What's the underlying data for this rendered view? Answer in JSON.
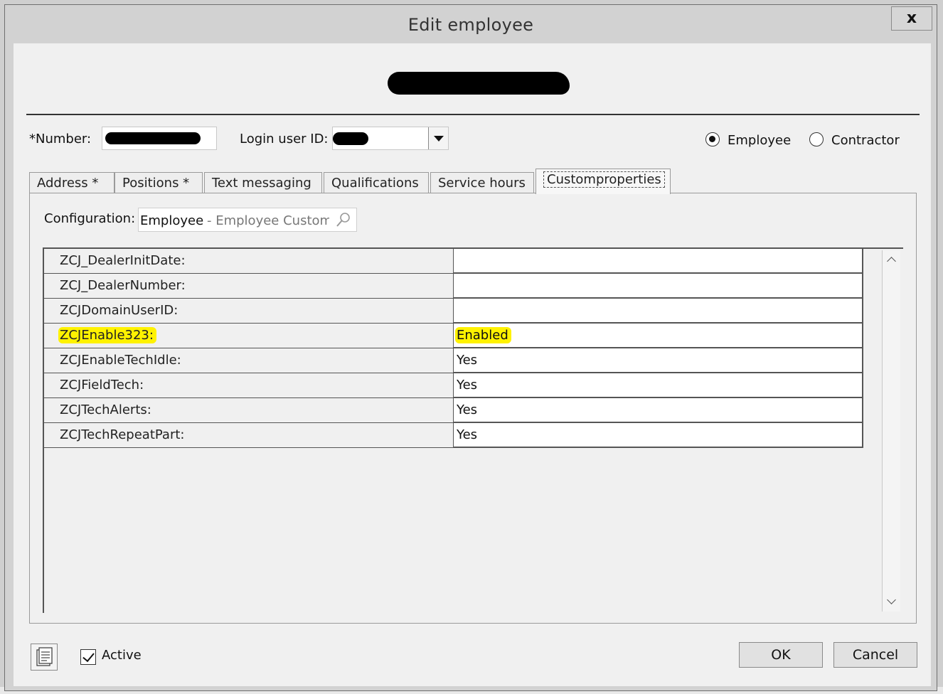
{
  "window": {
    "title": "Edit employee",
    "close_label": "x"
  },
  "employee_form": {
    "number_label": "*Number:",
    "login_label": "Login user ID:",
    "employment_type": {
      "options": [
        {
          "label": "Employee",
          "selected": true
        },
        {
          "label": "Contractor",
          "selected": false
        }
      ]
    }
  },
  "tabs": [
    {
      "label": "Address *",
      "active": false
    },
    {
      "label": "Positions *",
      "active": false
    },
    {
      "label": "Text messaging",
      "active": false
    },
    {
      "label": "Qualifications",
      "active": false
    },
    {
      "label": "Service hours",
      "active": false
    },
    {
      "label": "Customproperties",
      "active": true
    }
  ],
  "custom_properties": {
    "config_label": "Configuration:",
    "config_value": "Employee",
    "config_detail": "- Employee Custom Pr",
    "rows": [
      {
        "name": "ZCJ_DealerInitDate:",
        "value": ""
      },
      {
        "name": "ZCJ_DealerNumber:",
        "value": ""
      },
      {
        "name": "ZCJDomainUserID:",
        "value": ""
      },
      {
        "name": "ZCJEnable323:",
        "value": "Enabled",
        "highlighted": true
      },
      {
        "name": "ZCJEnableTechIdle:",
        "value": "Yes"
      },
      {
        "name": "ZCJFieldTech:",
        "value": "Yes"
      },
      {
        "name": "ZCJTechAlerts:",
        "value": "Yes"
      },
      {
        "name": "ZCJTechRepeatPart:",
        "value": "Yes"
      }
    ]
  },
  "footer": {
    "active_label": "Active",
    "active_checked": true,
    "ok_label": "OK",
    "cancel_label": "Cancel"
  },
  "colors": {
    "highlight": "#fff200",
    "dialog_bg": "#f0f0f0"
  },
  "icons": {
    "notes": "document-icon",
    "search": "search-icon"
  }
}
